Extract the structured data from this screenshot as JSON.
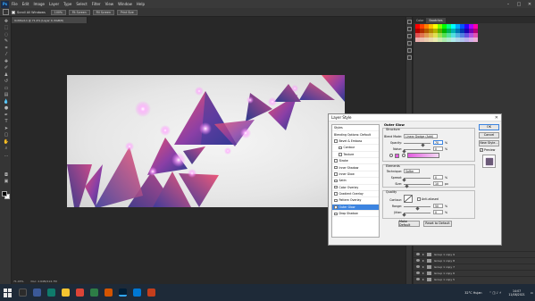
{
  "app": {
    "name": "Photoshop",
    "logo_text": "Ps",
    "menu": [
      "File",
      "Edit",
      "Image",
      "Layer",
      "Type",
      "Select",
      "Filter",
      "View",
      "Window",
      "Help"
    ]
  },
  "options_bar": {
    "checkbox_label": "Scroll All Windows",
    "buttons": [
      "100%",
      "Fit Screen",
      "Fill Screen",
      "Print Size"
    ]
  },
  "document": {
    "tab_title": "Untitled-1 @ 71.4% (Layer 0, RGB/8)",
    "status_zoom": "71.43%",
    "status_doc": "Doc: 2.64M/114.7M"
  },
  "panels": {
    "tabs": [
      "Color",
      "Swatches"
    ],
    "active_tab": "Swatches",
    "layers": [
      "Group 1 copy 9",
      "Group 1 copy 8",
      "Group 1 copy 7",
      "Group 1 copy 6",
      "Group 1 copy 5",
      "Group 1 copy 12",
      "Group 1 copy 11"
    ]
  },
  "layer_style": {
    "title": "Layer Style",
    "styles_list": [
      {
        "label": "Styles",
        "checkbox": false,
        "indent": false,
        "checked": false
      },
      {
        "label": "Blending Options: Default",
        "checkbox": false,
        "indent": false,
        "checked": false
      },
      {
        "label": "Bevel & Emboss",
        "checkbox": true,
        "indent": false,
        "checked": false
      },
      {
        "label": "Contour",
        "checkbox": true,
        "indent": true,
        "checked": false
      },
      {
        "label": "Texture",
        "checkbox": true,
        "indent": true,
        "checked": false
      },
      {
        "label": "Stroke",
        "checkbox": true,
        "indent": false,
        "checked": false
      },
      {
        "label": "Inner Shadow",
        "checkbox": true,
        "indent": false,
        "checked": false
      },
      {
        "label": "Inner Glow",
        "checkbox": true,
        "indent": false,
        "checked": false
      },
      {
        "label": "Satin",
        "checkbox": true,
        "indent": false,
        "checked": false
      },
      {
        "label": "Color Overlay",
        "checkbox": true,
        "indent": false,
        "checked": false
      },
      {
        "label": "Gradient Overlay",
        "checkbox": true,
        "indent": false,
        "checked": false
      },
      {
        "label": "Pattern Overlay",
        "checkbox": true,
        "indent": false,
        "checked": false
      },
      {
        "label": "Outer Glow",
        "checkbox": true,
        "indent": false,
        "checked": true
      },
      {
        "label": "Drop Shadow",
        "checkbox": true,
        "indent": false,
        "checked": false
      }
    ],
    "outer_glow": {
      "section_title": "Outer Glow",
      "structure_title": "Structure",
      "blend_mode_label": "Blend Mode:",
      "blend_mode": "Linear Dodge (Add)",
      "opacity_label": "Opacity:",
      "opacity": "70",
      "noise_label": "Noise:",
      "noise": "0",
      "elements_title": "Elements",
      "technique_label": "Technique:",
      "technique": "Softer",
      "spread_label": "Spread:",
      "spread": "0",
      "size_label": "Size:",
      "size": "10",
      "unit_percent": "%",
      "unit_px": "px",
      "quality_title": "Quality",
      "contour_label": "Contour:",
      "anti_aliased_label": "Anti-aliased",
      "range_label": "Range:",
      "range": "50",
      "jitter_label": "Jitter:",
      "jitter": "0",
      "make_default": "Make Default",
      "reset_default": "Reset to Default",
      "glow_color": "#e35be0"
    },
    "buttons": {
      "ok": "OK",
      "cancel": "Cancel",
      "new_style": "New Style...",
      "preview": "Preview"
    }
  },
  "taskbar": {
    "weather": "32°C  Hujan",
    "time": "14:07",
    "date": "11/08/2021"
  },
  "colors": {
    "accent": "#3c84e0",
    "tri_dark": "#2a3a8c",
    "tri_pink": "#e8506e",
    "tri_purple": "#7a3fa8",
    "glow": "#ffb0ff"
  }
}
